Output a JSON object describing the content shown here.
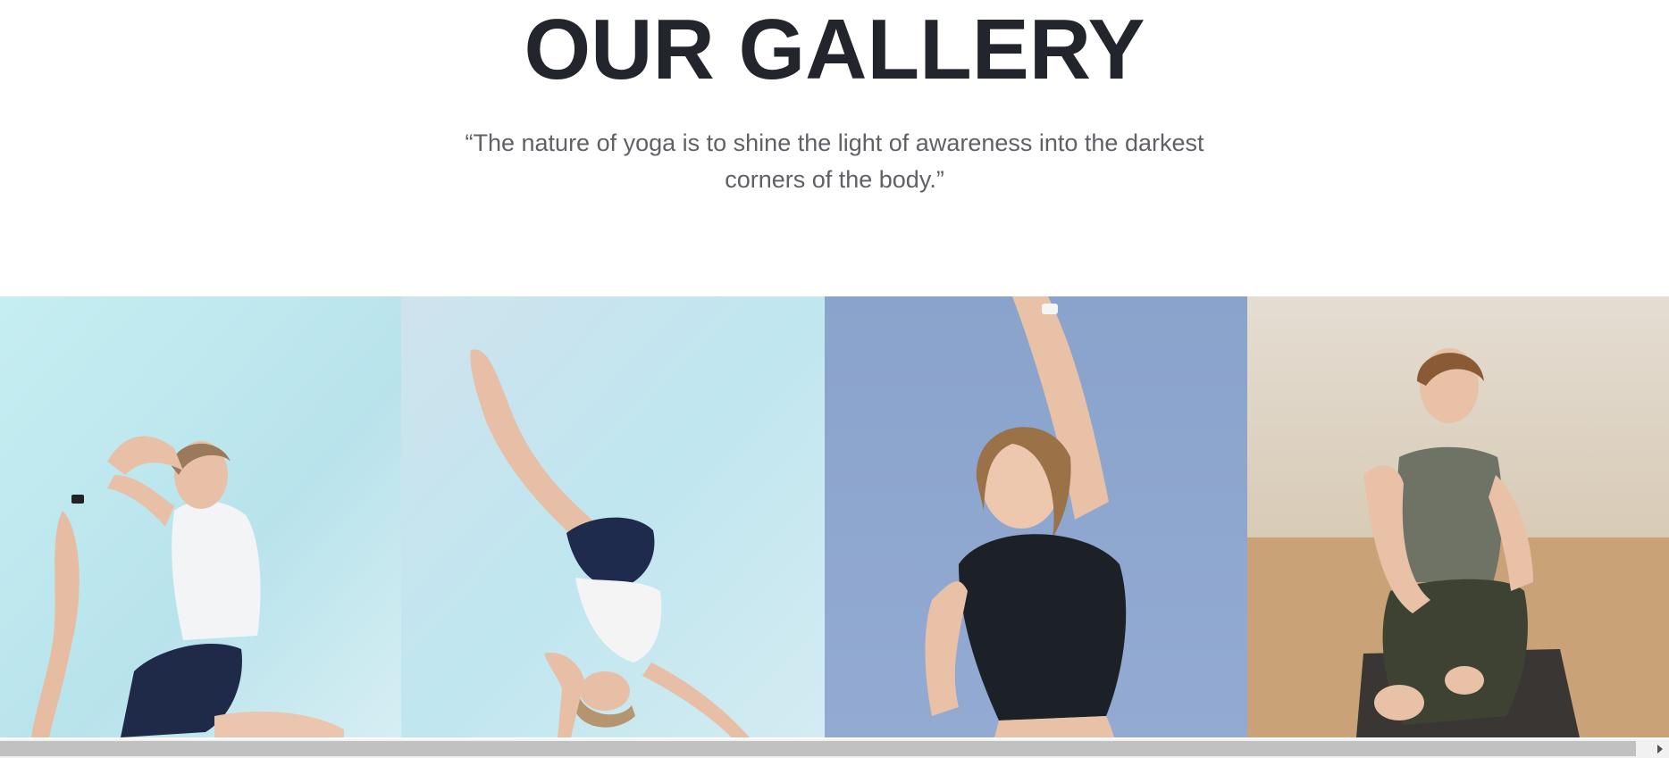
{
  "section": {
    "title": "OUR GALLERY",
    "quote": "“The nature of yoga is to shine the light of awareness into the darkest corners of the body.”"
  },
  "gallery": {
    "items": [
      {
        "name": "yoga-photo-king-pigeon-pose",
        "background": "#bfe8ee"
      },
      {
        "name": "yoga-photo-standing-split",
        "background": "#c8e6f0"
      },
      {
        "name": "yoga-photo-side-stretch",
        "background": "#8ea7cf"
      },
      {
        "name": "yoga-photo-seated-twist",
        "background": "#d9d2c4"
      }
    ]
  },
  "scrollbar": {
    "icon": "arrow-right-icon"
  }
}
